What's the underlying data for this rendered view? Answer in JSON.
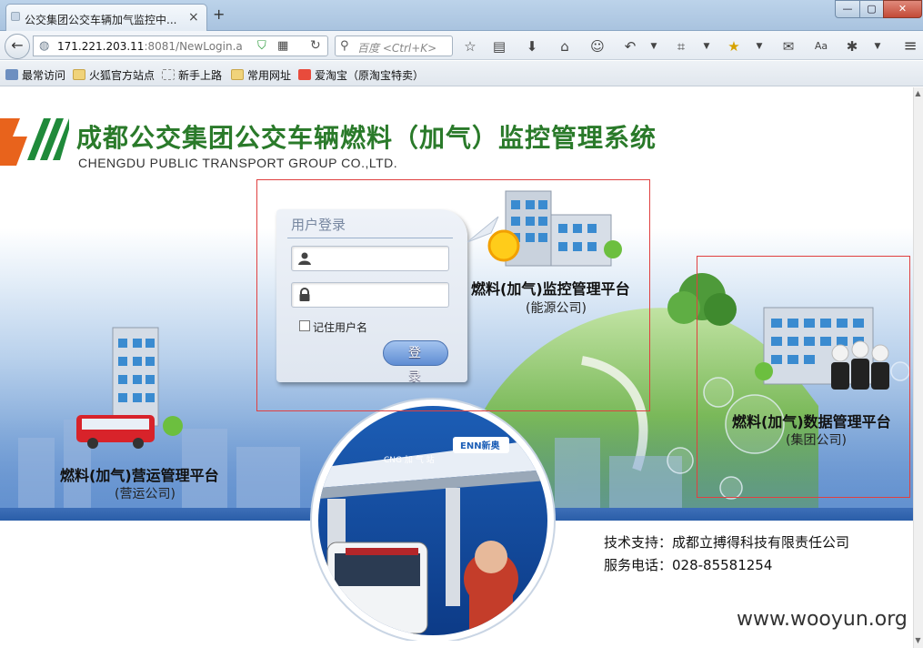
{
  "browser": {
    "tab_title": "公交集团公交车辆加气监控中...",
    "tab_close": "×",
    "new_tab": "+",
    "window_buttons": {
      "minimize": "—",
      "maximize": "▢",
      "close": "✕"
    },
    "url_host": "171.221.203.11",
    "url_rest": ":8081/NewLogin.a",
    "search_placeholder": "百度 <Ctrl+K>"
  },
  "bookmarks": [
    {
      "label": "最常访问",
      "icon": "globe-bookmark-icon"
    },
    {
      "label": "火狐官方站点",
      "icon": "folder-icon"
    },
    {
      "label": "新手上路",
      "icon": "dashed-folder-icon"
    },
    {
      "label": "常用网址",
      "icon": "folder-icon"
    },
    {
      "label": "爱淘宝（原淘宝特卖）",
      "icon": "taobao-icon"
    }
  ],
  "header": {
    "title": "成都公交集团公交车辆燃料（加气）监控管理系统",
    "subtitle": "CHENGDU PUBLIC TRANSPORT GROUP CO.,LTD."
  },
  "login": {
    "title": "用户登录",
    "username_value": "",
    "password_value": "",
    "remember_label": "记住用户名",
    "remember_checked": false,
    "submit_label": "登 录"
  },
  "platforms": {
    "monitor": {
      "title": "燃料(加气)监控管理平台",
      "subtitle": "(能源公司)"
    },
    "operations": {
      "title": "燃料(加气)营运管理平台",
      "subtitle": "(营运公司)"
    },
    "data": {
      "title": "燃料(加气)数据管理平台",
      "subtitle": "(集团公司)"
    }
  },
  "station_signs": {
    "enn": "ENN新奥",
    "cng": "CNG 加 气 站"
  },
  "footer": {
    "support": "技术支持：成都立搏得科技有限责任公司",
    "phone": "服务电话：028-85581254"
  },
  "watermark": "www.wooyun.org",
  "colors": {
    "title_green": "#2a7a2a",
    "logo_orange": "#e8631c",
    "band_blue": "#2a5ea8",
    "highlight_red": "#e04040"
  }
}
